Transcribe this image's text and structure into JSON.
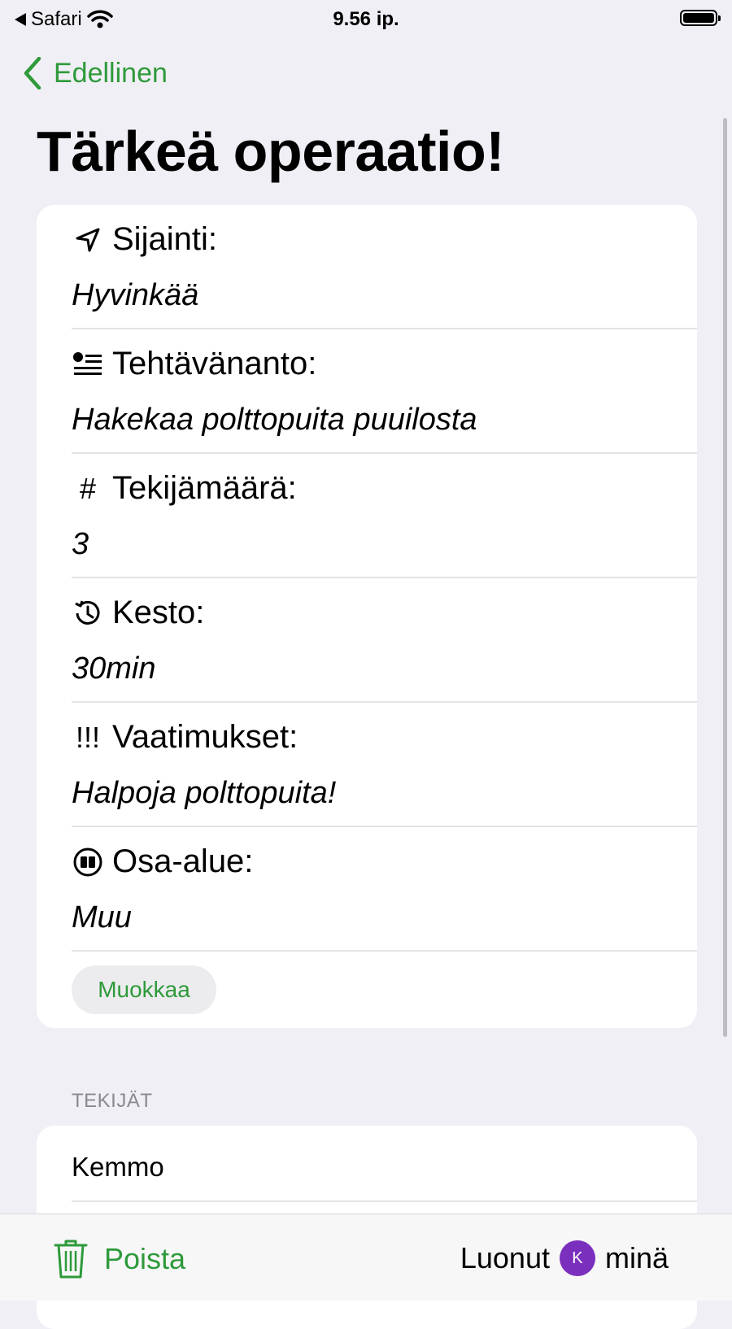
{
  "status_bar": {
    "back_app": "Safari",
    "time": "9.56 ip."
  },
  "nav": {
    "back_label": "Edellinen"
  },
  "title": "Tärkeä operaatio!",
  "details": [
    {
      "icon": "location-arrow-icon",
      "label": "Sijainti:",
      "value": "Hyvinkää"
    },
    {
      "icon": "checklist-icon",
      "label": "Tehtävänanto:",
      "value": "Hakekaa polttopuita puuilosta"
    },
    {
      "icon": "number-sign-icon",
      "label": "Tekijämäärä:",
      "value": "3"
    },
    {
      "icon": "clock-history-icon",
      "label": "Kesto:",
      "value": "30min"
    },
    {
      "icon": "exclamation-marks-icon",
      "label": "Vaatimukset:",
      "value": "Halpoja polttopuita!"
    },
    {
      "icon": "book-circle-icon",
      "label": "Osa-alue:",
      "value": "Muu"
    }
  ],
  "edit_button": "Muokkaa",
  "workers": {
    "header": "TEKIJÄT",
    "items": [
      "Kemmo"
    ]
  },
  "toolbar": {
    "delete_label": "Poista",
    "created_label": "Luonut",
    "avatar_initial": "K",
    "creator": "minä"
  },
  "colors": {
    "accent": "#2e9a3a",
    "background": "#f0eff5",
    "avatar": "#7b2fbd"
  }
}
